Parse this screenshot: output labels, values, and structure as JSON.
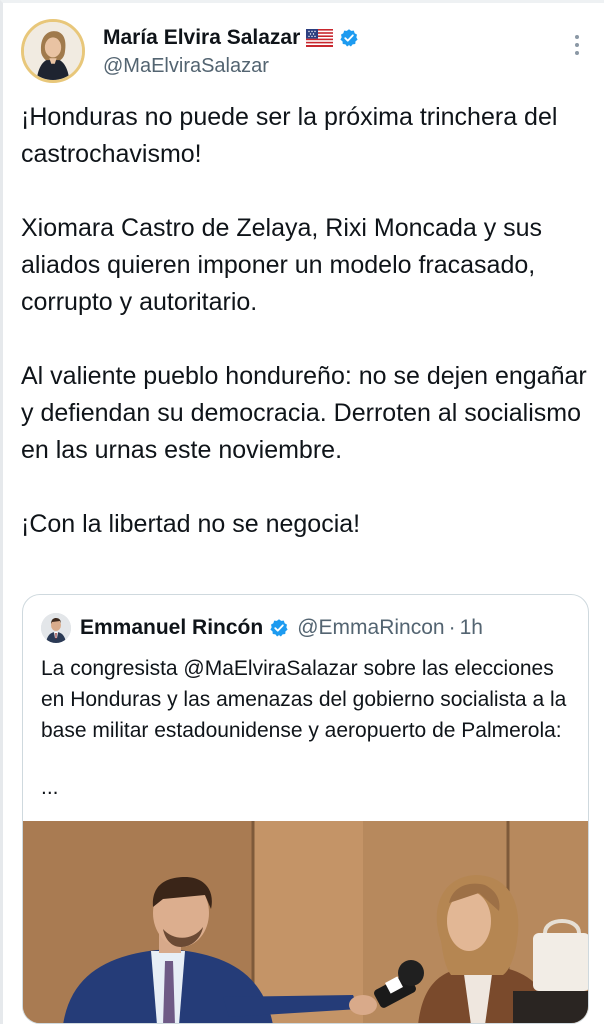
{
  "author": {
    "display_name": "María Elvira Salazar",
    "flag_icon": "us-flag-icon",
    "verified_icon": "verified-badge-icon",
    "handle": "@MaElviraSalazar"
  },
  "tweet": {
    "paragraphs": [
      "¡Honduras no puede ser la próxima trinchera del castrochavismo!",
      "Xiomara Castro de Zelaya, Rixi Moncada y sus aliados quieren imponer un modelo fracasado, corrupto y autoritario.",
      "Al valiente pueblo hondureño: no se dejen engañar y defiendan su democracia. Derroten al socialismo en las urnas este noviembre.",
      "¡Con la libertad no se negocia!"
    ]
  },
  "quote": {
    "display_name": "Emmanuel Rincón",
    "handle": "@EmmaRincon",
    "separator": "·",
    "time": "1h",
    "text": "La congresista @MaElviraSalazar sobre las elecciones en Honduras y las amenazas del gobierno socialista a la base militar estadounidense y aeropuerto de Palmerola:",
    "ellipsis": "...",
    "media_icon": "video-thumbnail"
  },
  "colors": {
    "verified": "#1d9bf0",
    "secondary_text": "#536471",
    "border": "#cfd9de"
  }
}
